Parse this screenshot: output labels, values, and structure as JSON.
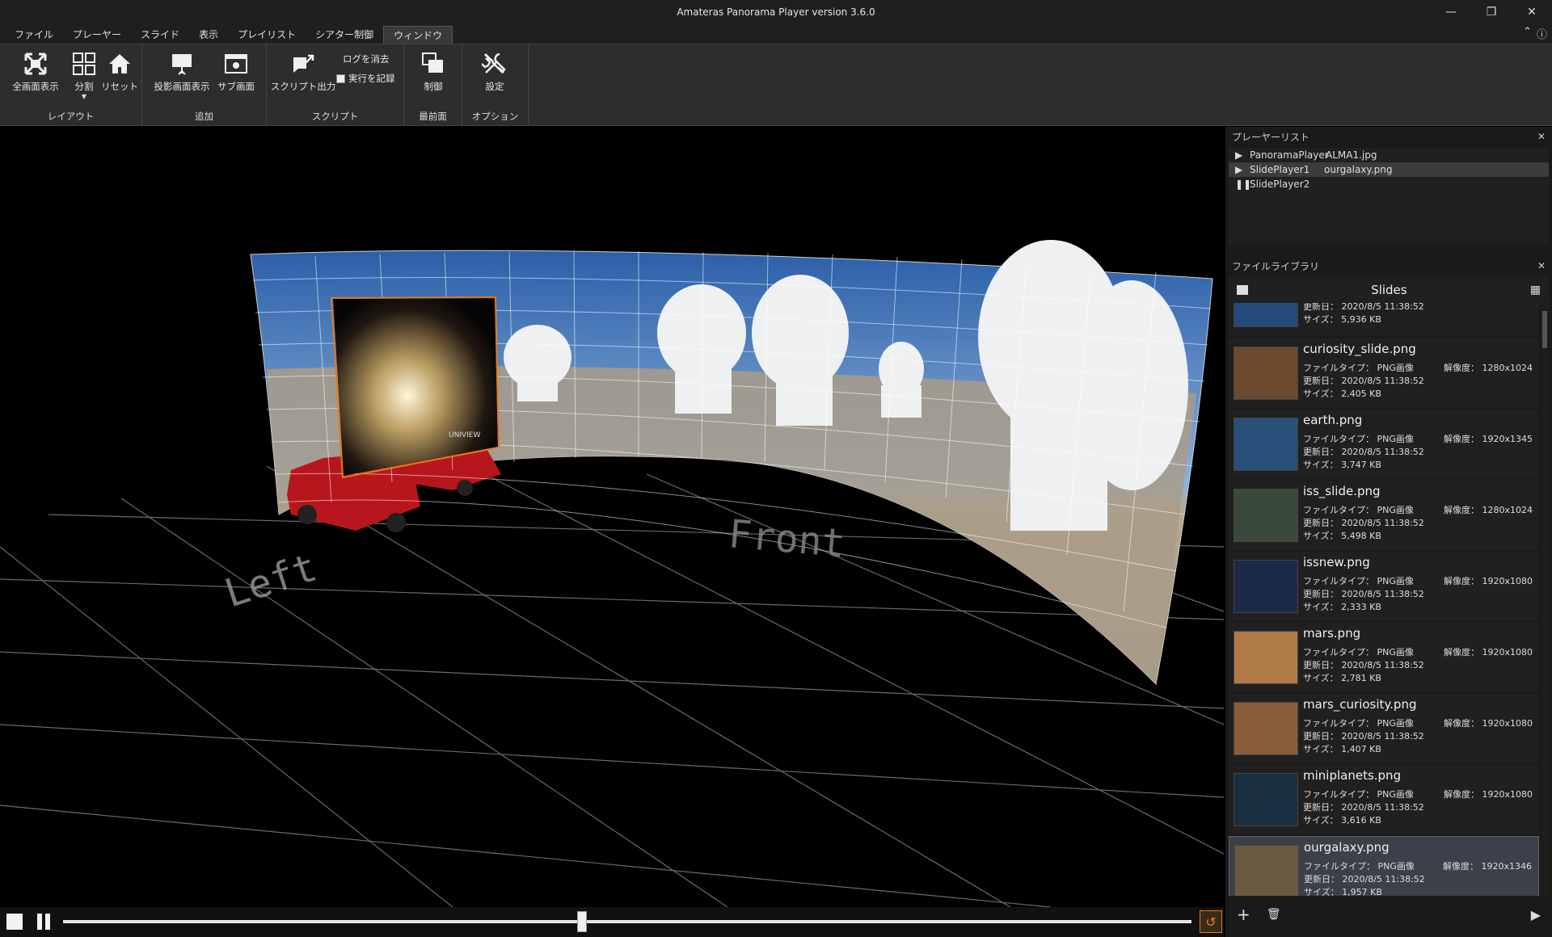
{
  "window": {
    "title": "Amateras Panorama Player version 3.6.0"
  },
  "menubar": {
    "items": [
      {
        "label": "ファイル"
      },
      {
        "label": "プレーヤー"
      },
      {
        "label": "スライド"
      },
      {
        "label": "表示"
      },
      {
        "label": "プレイリスト"
      },
      {
        "label": "シアター制御"
      },
      {
        "label": "ウィンドウ"
      }
    ]
  },
  "ribbon": {
    "layout": {
      "label": "レイアウト",
      "fullscreen": "全画面表示",
      "split": "分割",
      "reset": "リセット"
    },
    "add": {
      "label": "追加",
      "projection": "投影画面表示",
      "sub": "サブ画面"
    },
    "script": {
      "label": "スクリプト",
      "output": "スクリプト出力",
      "clear_log": "ログを消去",
      "record": "実行を記録"
    },
    "front": {
      "label": "最前面",
      "control": "制御"
    },
    "options": {
      "label": "オプション",
      "settings": "設定"
    }
  },
  "viewport": {
    "left_label": "Left",
    "front_label": "Front",
    "overlay_text": "UNIVIEW"
  },
  "playback": {
    "position": 0.46
  },
  "playerlist": {
    "title": "プレーヤーリスト",
    "rows": [
      {
        "name": "PanoramaPlayer",
        "file": "ALMA1.jpg",
        "state": "play"
      },
      {
        "name": "SlidePlayer1",
        "file": "ourgalaxy.png",
        "state": "play"
      },
      {
        "name": "SlidePlayer2",
        "file": "",
        "state": "pause"
      }
    ]
  },
  "library": {
    "title": "ファイルライブラリ",
    "folder": "Slides",
    "partial": {
      "updated": "更新日： 2020/8/5 11:38:52",
      "size": "サイズ： 5,936 KB"
    },
    "files": [
      {
        "name": "curiosity_slide.png",
        "type": "ファイルタイプ： PNG画像",
        "updated": "更新日： 2020/8/5 11:38:52",
        "size": "サイズ： 2,405 KB",
        "res": "解像度： 1280x1024"
      },
      {
        "name": "earth.png",
        "type": "ファイルタイプ： PNG画像",
        "updated": "更新日： 2020/8/5 11:38:52",
        "size": "サイズ： 3,747 KB",
        "res": "解像度： 1920x1345"
      },
      {
        "name": "iss_slide.png",
        "type": "ファイルタイプ： PNG画像",
        "updated": "更新日： 2020/8/5 11:38:52",
        "size": "サイズ： 5,498 KB",
        "res": "解像度： 1280x1024"
      },
      {
        "name": "issnew.png",
        "type": "ファイルタイプ： PNG画像",
        "updated": "更新日： 2020/8/5 11:38:52",
        "size": "サイズ： 2,333 KB",
        "res": "解像度： 1920x1080"
      },
      {
        "name": "mars.png",
        "type": "ファイルタイプ： PNG画像",
        "updated": "更新日： 2020/8/5 11:38:52",
        "size": "サイズ： 2,781 KB",
        "res": "解像度： 1920x1080"
      },
      {
        "name": "mars_curiosity.png",
        "type": "ファイルタイプ： PNG画像",
        "updated": "更新日： 2020/8/5 11:38:52",
        "size": "サイズ： 1,407 KB",
        "res": "解像度： 1920x1080"
      },
      {
        "name": "miniplanets.png",
        "type": "ファイルタイプ： PNG画像",
        "updated": "更新日： 2020/8/5 11:38:52",
        "size": "サイズ： 3,616 KB",
        "res": "解像度： 1920x1080"
      },
      {
        "name": "ourgalaxy.png",
        "type": "ファイルタイプ： PNG画像",
        "updated": "更新日： 2020/8/5 11:38:52",
        "size": "サイズ： 1,957 KB",
        "res": "解像度： 1920x1346"
      }
    ]
  },
  "colors": {
    "accent": "#e8781e",
    "selected": "#3b4049"
  }
}
